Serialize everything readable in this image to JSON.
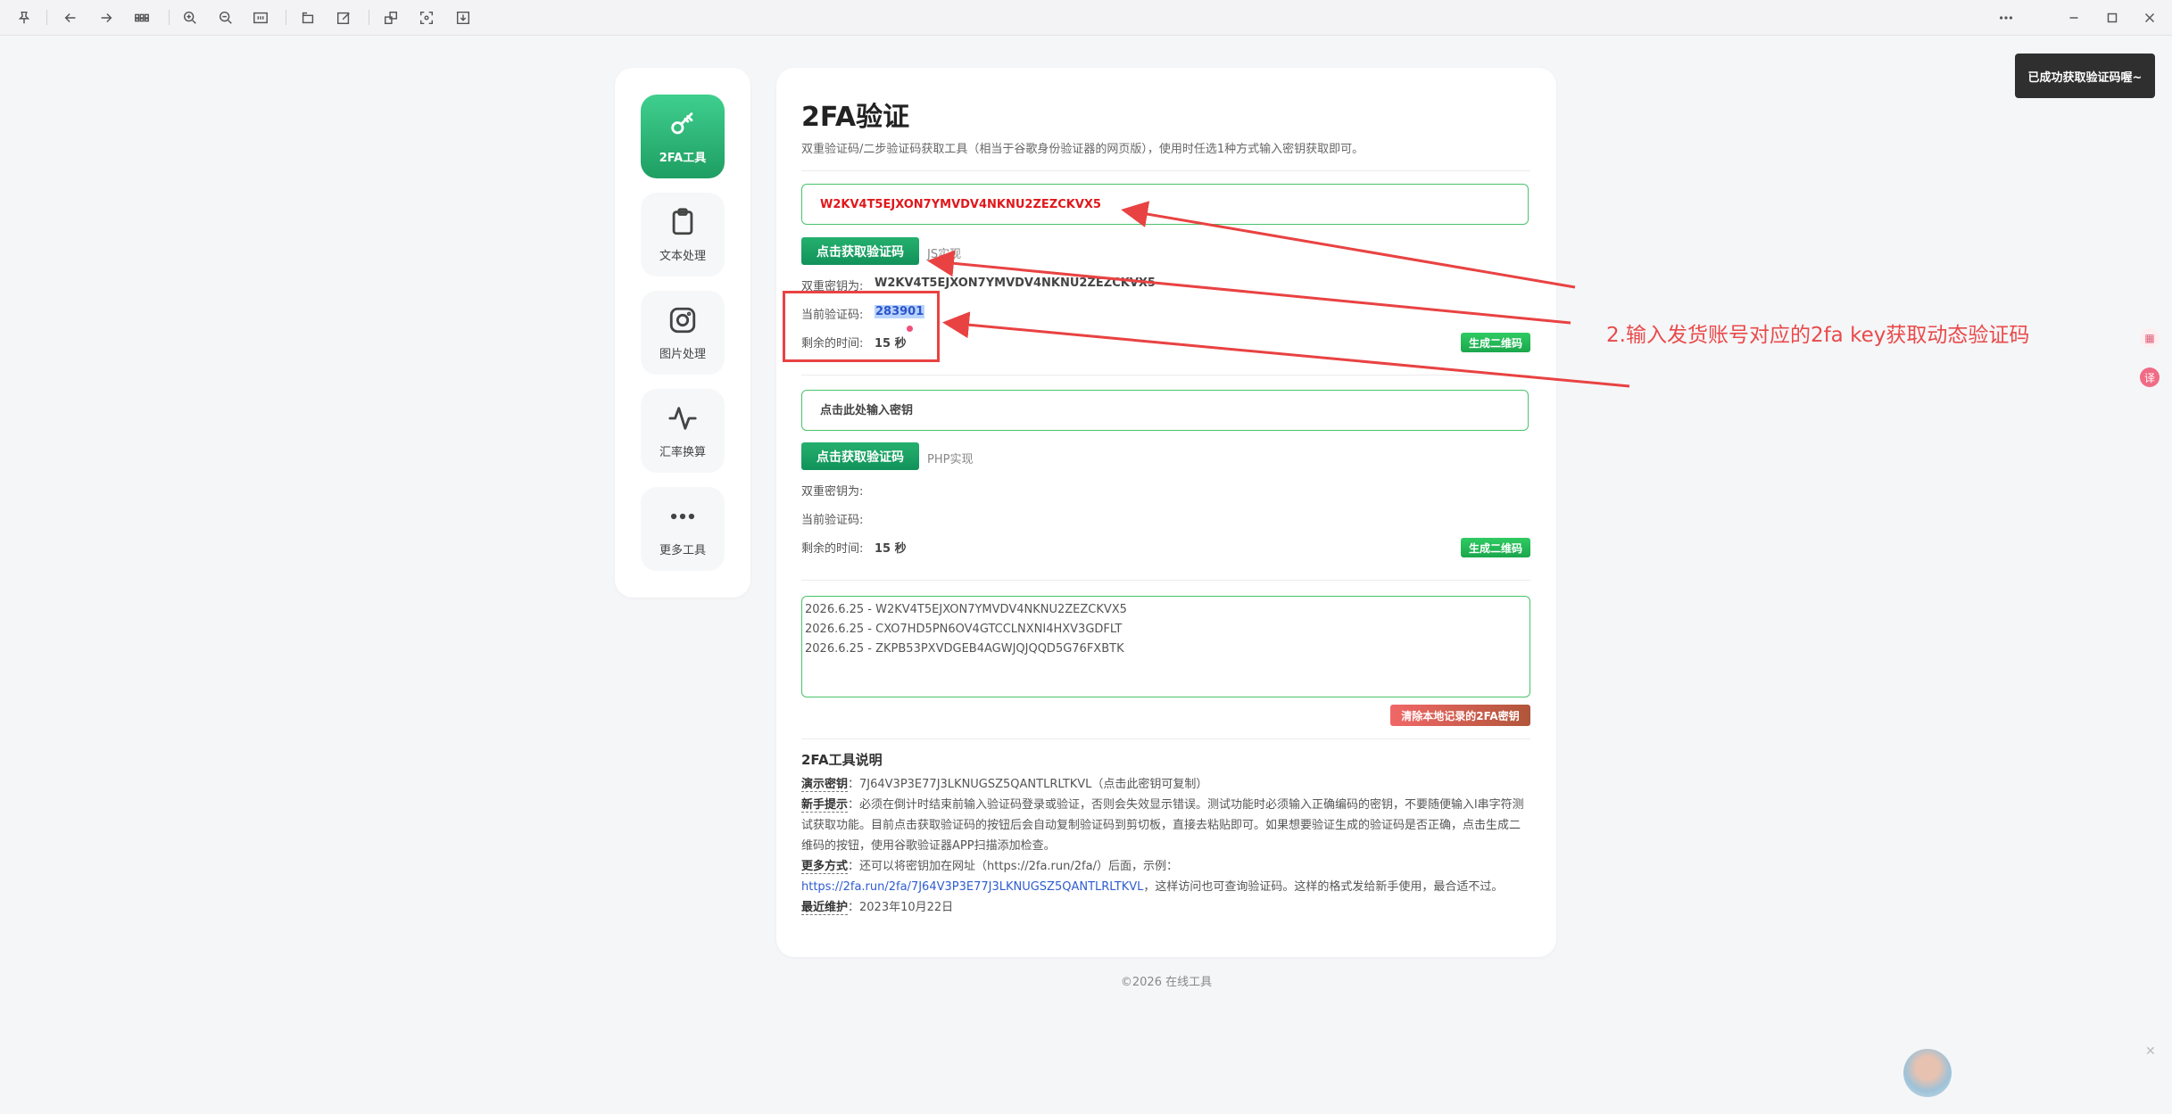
{
  "sidebar": {
    "items": [
      {
        "label": "2FA工具",
        "icon": "key-icon"
      },
      {
        "label": "文本处理",
        "icon": "clipboard-icon"
      },
      {
        "label": "图片处理",
        "icon": "camera-icon"
      },
      {
        "label": "汇率换算",
        "icon": "activity-icon"
      },
      {
        "label": "更多工具",
        "icon": "more-icon"
      }
    ]
  },
  "main": {
    "title": "2FA验证",
    "subtitle": "双重验证码/二步验证码获取工具（相当于谷歌身份验证器的网页版），使用时任选1种方式输入密钥获取即可。",
    "js_section": {
      "key_value": "W2KV4T5EJXON7YMVDV4NKNU2ZEZCKVX5",
      "button_label": "点击获取验证码",
      "impl_label": "JS实现",
      "secret_label": "双重密钥为:",
      "secret_value": "W2KV4T5EJXON7YMVDV4NKNU2ZEZCKVX5",
      "code_label": "当前验证码:",
      "code_value": "283901",
      "time_label": "剩余的时间:",
      "time_value": "15 秒",
      "qr_label": "生成二维码"
    },
    "php_section": {
      "key_placeholder": "点击此处输入密钥",
      "button_label": "点击获取验证码",
      "impl_label": "PHP实现",
      "secret_label": "双重密钥为:",
      "code_label": "当前验证码:",
      "time_label": "剩余的时间:",
      "time_value": "15 秒",
      "qr_label": "生成二维码"
    },
    "records": [
      "2026.6.25 - W2KV4T5EJXON7YMVDV4NKNU2ZEZCKVX5",
      "2026.6.25 - CXO7HD5PN6OV4GTCCLNXNI4HXV3GDFLT",
      "2026.6.25 - ZKPB53PXVDGEB4AGWJQJQQD5G76FXBTK"
    ],
    "clear_label": "清除本地记录的2FA密钥",
    "desc": {
      "title": "2FA工具说明",
      "demo_key_label": "演示密钥",
      "demo_key_value": "：7J64V3P3E77J3LKNUGSZ5QANTLRLTKVL（点击此密钥可复制）",
      "tips_label": "新手提示",
      "tips_value": "：必须在倒计时结束前输入验证码登录或验证，否则会失效显示错误。测试功能时必须输入正确编码的密钥，不要随便输入l串字符测试获取功能。目前点击获取验证码的按钮后会自动复制验证码到剪切板，直接去粘贴即可。如果想要验证生成的验证码是否正确，点击生成二维码的按钮，使用谷歌验证器APP扫描添加检查。",
      "more_label": "更多方式",
      "more_value": "：还可以将密钥加在网址（https://2fa.run/2fa/）后面，示例：",
      "more_link": "https://2fa.run/2fa/7J64V3P3E77J3LKNUGSZ5QANTLRLTKVL",
      "more_tail": "，这样访问也可查询验证码。这样的格式发给新手使用，最合适不过。",
      "updated_label": "最近维护",
      "updated_value": "：2023年10月22日"
    }
  },
  "footer": "©2026 在线工具",
  "toast": "已成功获取验证码喔~",
  "annotation": "2.输入发货账号对应的2fa key获取动态验证码",
  "colors": {
    "accent": "#1e9e62",
    "annotation": "#e94242",
    "link": "#2f5ccf"
  }
}
